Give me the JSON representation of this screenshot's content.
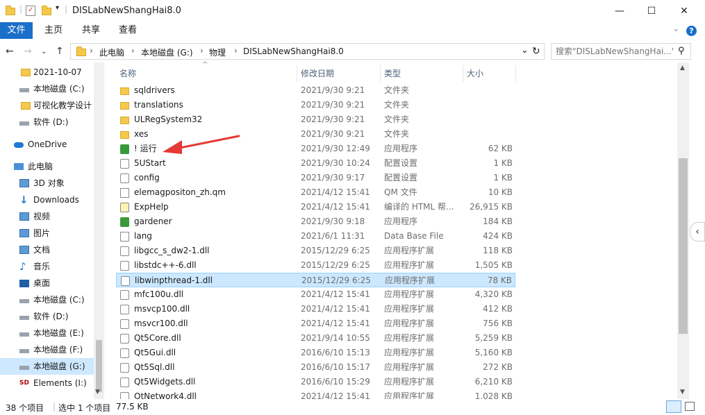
{
  "window": {
    "title": "DISLabNewShangHai8.0",
    "controls": {
      "minimize": "—",
      "maximize": "☐",
      "close": "✕"
    }
  },
  "ribbon": {
    "tabs": [
      "文件",
      "主页",
      "共享",
      "查看"
    ],
    "help": "?",
    "expand": "⌄"
  },
  "address": {
    "crumbs": [
      "此电脑",
      "本地磁盘 (G:)",
      "物理",
      "DISLabNewShangHai8.0"
    ],
    "refresh": "↻",
    "dropdown": "⌄"
  },
  "search": {
    "placeholder": "搜索\"DISLabNewShangHai...\""
  },
  "nav": {
    "items": [
      {
        "label": "2021-10-07",
        "icon": "folder-icon"
      },
      {
        "label": "本地磁盘 (C:)",
        "icon": "drive-icon"
      },
      {
        "label": "可视化教学设计",
        "icon": "folder-icon"
      },
      {
        "label": "软件 (D:)",
        "icon": "drive-icon"
      },
      {
        "label": "OneDrive",
        "icon": "onedrive-icon"
      },
      {
        "label": "此电脑",
        "icon": "computer-icon"
      },
      {
        "label": "3D 对象",
        "icon": "3d-objects-icon"
      },
      {
        "label": "Downloads",
        "icon": "downloads-icon"
      },
      {
        "label": "视频",
        "icon": "video-icon"
      },
      {
        "label": "图片",
        "icon": "pictures-icon"
      },
      {
        "label": "文档",
        "icon": "documents-icon"
      },
      {
        "label": "音乐",
        "icon": "music-icon"
      },
      {
        "label": "桌面",
        "icon": "desktop-icon"
      },
      {
        "label": "本地磁盘 (C:)",
        "icon": "drive-icon"
      },
      {
        "label": "软件 (D:)",
        "icon": "drive-icon"
      },
      {
        "label": "本地磁盘 (E:)",
        "icon": "drive-icon"
      },
      {
        "label": "本地磁盘 (F:)",
        "icon": "drive-icon"
      },
      {
        "label": "本地磁盘 (G:)",
        "icon": "drive-icon",
        "selected": true
      },
      {
        "label": "Elements (I:)",
        "icon": "external-drive-icon"
      }
    ]
  },
  "columns": {
    "name": "名称",
    "date": "修改日期",
    "type": "类型",
    "size": "大小"
  },
  "files": [
    {
      "name": "sqldrivers",
      "date": "2021/9/30 9:21",
      "type": "文件夹",
      "size": "",
      "icon": "folder-icon"
    },
    {
      "name": "translations",
      "date": "2021/9/30 9:21",
      "type": "文件夹",
      "size": "",
      "icon": "folder-icon"
    },
    {
      "name": "ULRegSystem32",
      "date": "2021/9/30 9:21",
      "type": "文件夹",
      "size": "",
      "icon": "folder-icon"
    },
    {
      "name": "xes",
      "date": "2021/9/30 9:21",
      "type": "文件夹",
      "size": "",
      "icon": "folder-icon"
    },
    {
      "name": "! 运行",
      "date": "2021/9/30 12:49",
      "type": "应用程序",
      "size": "62 KB",
      "icon": "app-green-icon"
    },
    {
      "name": "5UStart",
      "date": "2021/9/30 10:24",
      "type": "配置设置",
      "size": "1 KB",
      "icon": "config-icon"
    },
    {
      "name": "config",
      "date": "2021/9/30 9:17",
      "type": "配置设置",
      "size": "1 KB",
      "icon": "config-icon"
    },
    {
      "name": "elemagpositon_zh.qm",
      "date": "2021/4/12 15:41",
      "type": "QM 文件",
      "size": "10 KB",
      "icon": "file-icon"
    },
    {
      "name": "ExpHelp",
      "date": "2021/4/12 15:41",
      "type": "编译的 HTML 帮...",
      "size": "26,915 KB",
      "icon": "help-icon"
    },
    {
      "name": "gardener",
      "date": "2021/9/30 9:18",
      "type": "应用程序",
      "size": "184 KB",
      "icon": "app-green-icon"
    },
    {
      "name": "lang",
      "date": "2021/6/1 11:31",
      "type": "Data Base File",
      "size": "424 KB",
      "icon": "file-icon"
    },
    {
      "name": "libgcc_s_dw2-1.dll",
      "date": "2015/12/29 6:25",
      "type": "应用程序扩展",
      "size": "118 KB",
      "icon": "dll-icon"
    },
    {
      "name": "libstdc++-6.dll",
      "date": "2015/12/29 6:25",
      "type": "应用程序扩展",
      "size": "1,505 KB",
      "icon": "dll-icon"
    },
    {
      "name": "libwinpthread-1.dll",
      "date": "2015/12/29 6:25",
      "type": "应用程序扩展",
      "size": "78 KB",
      "icon": "dll-icon",
      "selected": true
    },
    {
      "name": "mfc100u.dll",
      "date": "2021/4/12 15:41",
      "type": "应用程序扩展",
      "size": "4,320 KB",
      "icon": "dll-icon"
    },
    {
      "name": "msvcp100.dll",
      "date": "2021/4/12 15:41",
      "type": "应用程序扩展",
      "size": "412 KB",
      "icon": "dll-icon"
    },
    {
      "name": "msvcr100.dll",
      "date": "2021/4/12 15:41",
      "type": "应用程序扩展",
      "size": "756 KB",
      "icon": "dll-icon"
    },
    {
      "name": "Qt5Core.dll",
      "date": "2021/9/14 10:55",
      "type": "应用程序扩展",
      "size": "5,259 KB",
      "icon": "dll-icon"
    },
    {
      "name": "Qt5Gui.dll",
      "date": "2016/6/10 15:13",
      "type": "应用程序扩展",
      "size": "5,160 KB",
      "icon": "dll-icon"
    },
    {
      "name": "Qt5Sql.dll",
      "date": "2016/6/10 15:17",
      "type": "应用程序扩展",
      "size": "272 KB",
      "icon": "dll-icon"
    },
    {
      "name": "Qt5Widgets.dll",
      "date": "2016/6/10 15:29",
      "type": "应用程序扩展",
      "size": "6,210 KB",
      "icon": "dll-icon"
    },
    {
      "name": "QtNetwork4.dll",
      "date": "2021/4/12 15:41",
      "type": "应用程序扩展",
      "size": "1,028 KB",
      "icon": "dll-icon"
    }
  ],
  "status": {
    "count": "38 个项目",
    "selection": "选中 1 个项目",
    "selsize": "77.5 KB"
  },
  "colors": {
    "accent": "#1a6fc9",
    "selection": "#cce8ff",
    "annotation": "#e53935"
  }
}
